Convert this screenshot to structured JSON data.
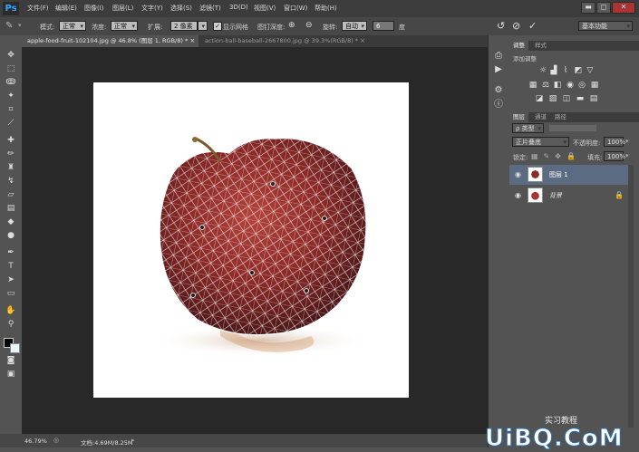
{
  "app": {
    "logo": "Ps"
  },
  "menu": [
    "文件(F)",
    "编辑(E)",
    "图像(I)",
    "图层(L)",
    "文字(Y)",
    "选择(S)",
    "滤镜(T)",
    "3D(D)",
    "视图(V)",
    "窗口(W)",
    "帮助(H)"
  ],
  "window_controls": {
    "minimize": "▬",
    "restore": "◻",
    "close": "✕"
  },
  "options": {
    "mode_label": "模式:",
    "mode_value": "正常",
    "density_label": "浓度:",
    "density_value": "正常",
    "expand_label": "扩展:",
    "expand_value": "2 像素",
    "show_mesh": "显示网格",
    "pin_depth_label": "图钉深度:",
    "rotate_label": "旋转:",
    "rotate_value": "自动",
    "rotate_degrees": "6",
    "degree_unit": "度",
    "workspace": "基本功能"
  },
  "tabs": [
    {
      "label": "apple-food-fruit-102104.jpg @ 46.8% (图层 1, RGB/8) *",
      "close": "×",
      "active": true
    },
    {
      "label": "action-ball-baseball-2667800.jpg @ 39.3%(RGB/8) *",
      "close": "×",
      "active": false
    }
  ],
  "status": {
    "zoom": "46.79%",
    "doc_info": "文档:4.69M/8.25M"
  },
  "panels": {
    "adjust_tabs": [
      "调整",
      "样式"
    ],
    "adjust_title": "添加调整",
    "layer_tabs": [
      "图层",
      "通道",
      "路径"
    ],
    "kind_filter": "ρ 类型",
    "blend_mode": "正片叠底",
    "opacity_label": "不透明度:",
    "opacity_value": "100%",
    "lock_label": "锁定:",
    "fill_label": "填充:",
    "fill_value": "100%",
    "layers": [
      {
        "name": "图层 1",
        "selected": true
      },
      {
        "name": "背景",
        "selected": false
      }
    ]
  },
  "watermark": {
    "text": "UiBQ.CoM",
    "sub": "实习教程"
  },
  "colors": {
    "accent": "#31a8ff",
    "canvas_bg": "#282828",
    "panel_bg": "#535353",
    "selected_layer": "#5a6b82",
    "mesh": "#ffffff",
    "apple_dark": "#5e1a1a",
    "apple_red": "#9b2f2c"
  }
}
